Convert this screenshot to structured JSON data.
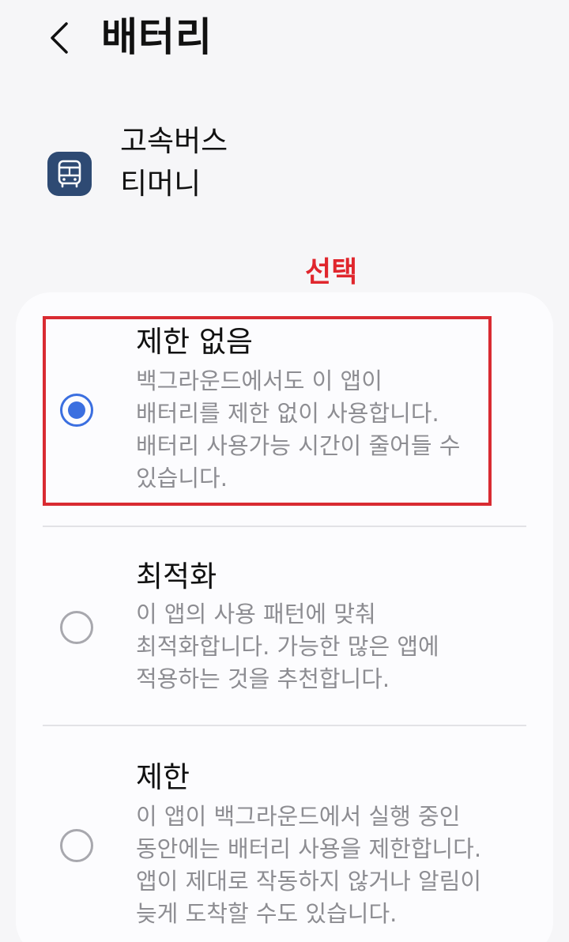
{
  "header": {
    "back_icon": "chevron-left-icon",
    "title": "배터리"
  },
  "app": {
    "name_line1": "고속버스",
    "name_line2": "티머니",
    "icon": "bus-icon",
    "icon_color": "#2e4a73"
  },
  "annotation": {
    "label": "선택",
    "color": "#e0262d"
  },
  "options": [
    {
      "title": "제한 없음",
      "desc_lines": [
        "백그라운드에서도 이 앱이",
        "배터리를 제한 없이 사용합니다.",
        "배터리 사용가능 시간이 줄어들 수",
        "있습니다."
      ],
      "selected": true
    },
    {
      "title": "최적화",
      "desc_lines": [
        "이 앱의 사용 패턴에 맞춰",
        "최적화합니다. 가능한 많은 앱에",
        "적용하는 것을 추천합니다."
      ],
      "selected": false
    },
    {
      "title": "제한",
      "desc_lines": [
        "이 앱이 백그라운드에서 실행 중인",
        "동안에는 배터리 사용을 제한합니다.",
        "앱이 제대로 작동하지 않거나 알림이",
        "늦게 도착할 수도 있습니다."
      ],
      "selected": false
    }
  ],
  "colors": {
    "accent": "#3b6fe0",
    "highlight": "#d92b32"
  }
}
